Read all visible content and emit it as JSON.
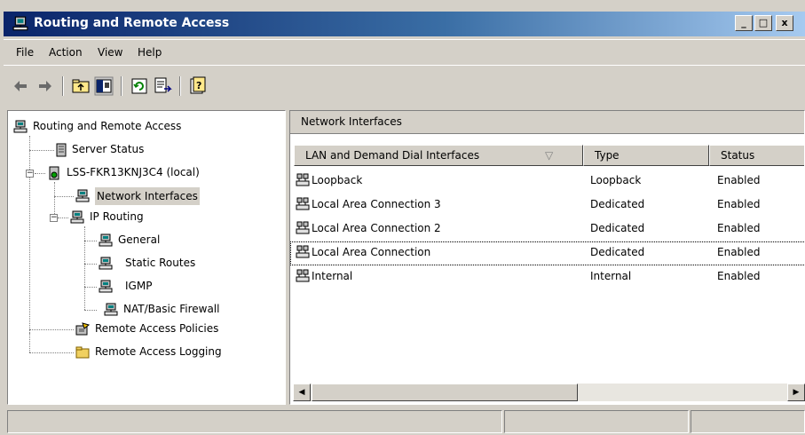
{
  "window": {
    "title": "Routing and Remote Access",
    "controls": {
      "minimize": "_",
      "maximize": "□",
      "close": "x"
    }
  },
  "menu": [
    "File",
    "Action",
    "View",
    "Help"
  ],
  "toolbar": {
    "buttons": [
      "back-icon",
      "forward-icon",
      "up-folder-icon",
      "show-hide-tree-icon",
      "refresh-icon",
      "export-list-icon",
      "help-icon"
    ]
  },
  "tree": {
    "root": "Routing and Remote Access",
    "server_status": "Server Status",
    "server": "LSS-FKR13KNJ3C4 (local)",
    "network_interfaces": "Network Interfaces",
    "ip_routing": "IP Routing",
    "general": "General",
    "static_routes": "Static Routes",
    "igmp": "IGMP",
    "nat": "NAT/Basic Firewall",
    "policies": "Remote Access Policies",
    "logging": "Remote Access Logging",
    "expander_minus": "−"
  },
  "details": {
    "pane_title": "Network Interfaces",
    "columns": [
      "LAN and Demand Dial Interfaces",
      "Type",
      "Status"
    ],
    "sort_indicator": "▽",
    "rows": [
      {
        "name": "Loopback",
        "type": "Loopback",
        "status": "Enabled"
      },
      {
        "name": "Local Area Connection 3",
        "type": "Dedicated",
        "status": "Enabled"
      },
      {
        "name": "Local Area Connection 2",
        "type": "Dedicated",
        "status": "Enabled"
      },
      {
        "name": "Local Area Connection",
        "type": "Dedicated",
        "status": "Enabled"
      },
      {
        "name": "Internal",
        "type": "Internal",
        "status": "Enabled"
      }
    ]
  },
  "scrollbar": {
    "left_arrow": "◀",
    "right_arrow": "▶"
  },
  "colors": {
    "title_start": "#0a246a",
    "title_end": "#a6caf0",
    "face": "#d4d0c8"
  }
}
